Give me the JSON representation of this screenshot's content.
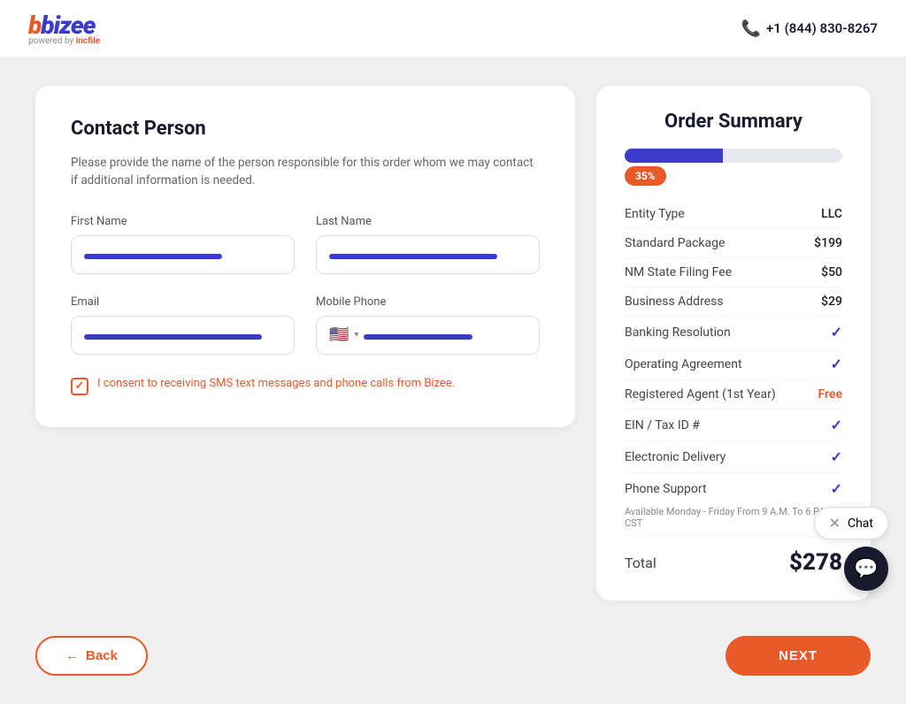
{
  "header": {
    "logo_text": "bizee",
    "logo_powered": "powered by",
    "logo_incfile": "incfile",
    "phone_label": "+1 (844) 830-8267"
  },
  "left_card": {
    "title": "Contact Person",
    "description": "Please provide the name of the person responsible for this order whom we may contact if additional information is needed.",
    "fields": {
      "first_name_label": "First Name",
      "last_name_label": "Last Name",
      "email_label": "Email",
      "mobile_phone_label": "Mobile Phone"
    },
    "sms_consent": "I consent to receiving SMS text messages and phone calls from Bizee."
  },
  "right_card": {
    "title": "Order Summary",
    "progress_percent": "35%",
    "items": [
      {
        "label": "Entity Type",
        "value": "LLC",
        "type": "text"
      },
      {
        "label": "Standard Package",
        "value": "$199",
        "type": "text"
      },
      {
        "label": "NM State Filing Fee",
        "value": "$50",
        "type": "text"
      },
      {
        "label": "Business Address",
        "value": "$29",
        "type": "text"
      },
      {
        "label": "Banking Resolution",
        "value": "check",
        "type": "check"
      },
      {
        "label": "Operating Agreement",
        "value": "check",
        "type": "check"
      },
      {
        "label": "Registered Agent (1st Year)",
        "value": "Free",
        "type": "free"
      },
      {
        "label": "EIN / Tax ID #",
        "value": "check",
        "type": "check"
      },
      {
        "label": "Electronic Delivery",
        "value": "check",
        "type": "check"
      },
      {
        "label": "Phone Support",
        "value": "check",
        "type": "check"
      }
    ],
    "phone_support_note": "Available Monday - Friday From 9 A.M. To 6 P.M. CST",
    "total_label": "Total",
    "total_amount": "$278"
  },
  "buttons": {
    "back_label": "Back",
    "next_label": "NEXT"
  },
  "chat": {
    "label": "Chat",
    "icon": "💬"
  }
}
